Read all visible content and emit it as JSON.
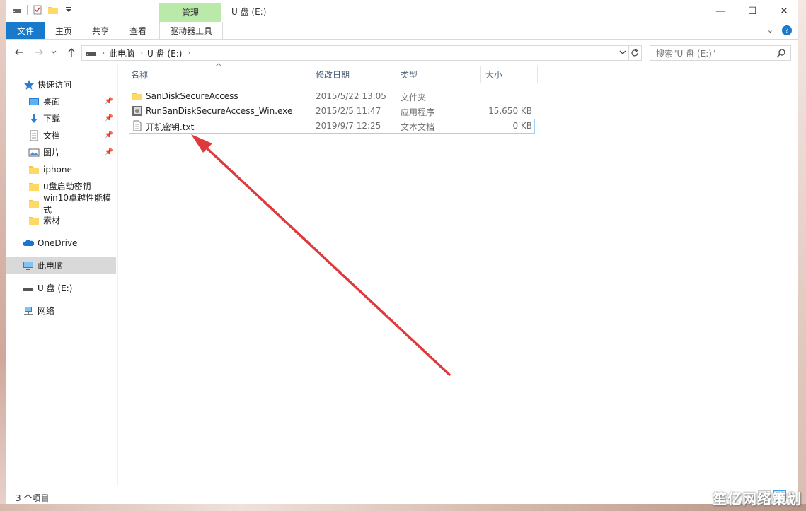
{
  "window": {
    "title": "U 盘 (E:)",
    "manage_tab": "管理",
    "controls": {
      "minimize": "—",
      "maximize": "☐",
      "close": "✕"
    }
  },
  "ribbon": {
    "tabs": [
      "文件",
      "主页",
      "共享",
      "查看",
      "驱动器工具"
    ],
    "expand_glyph": "⌄",
    "help_glyph": "?"
  },
  "address": {
    "crumbs": [
      "此电脑",
      "U 盘 (E:)"
    ],
    "search_placeholder": "搜索\"U 盘 (E:)\""
  },
  "sidebar": {
    "quick_access": "快速访问",
    "pinned": [
      "桌面",
      "下载",
      "文档",
      "图片"
    ],
    "folders": [
      "iphone",
      "u盘启动密钥",
      "win10卓越性能模式",
      "素材"
    ],
    "onedrive": "OneDrive",
    "this_pc": "此电脑",
    "usb": "U 盘 (E:)",
    "network": "网络"
  },
  "columns": [
    "名称",
    "修改日期",
    "类型",
    "大小"
  ],
  "files": [
    {
      "name": "SanDiskSecureAccess",
      "date": "2015/5/22 13:05",
      "type": "文件夹",
      "size": "",
      "icon": "folder-icon"
    },
    {
      "name": "RunSanDiskSecureAccess_Win.exe",
      "date": "2015/2/5 11:47",
      "type": "应用程序",
      "size": "15,650 KB",
      "icon": "exe-icon"
    },
    {
      "name": "开机密钥.txt",
      "date": "2019/9/7 12:25",
      "type": "文本文档",
      "size": "0 KB",
      "icon": "text-file-icon",
      "selected": true
    }
  ],
  "status": {
    "item_count": "3 个项目"
  },
  "watermark": "笙亿网络策划",
  "colors": {
    "accent": "#1979ca",
    "manage_tab": "#b9eaa9",
    "arrow": "#e0393c",
    "selection_border": "#99d1ff"
  }
}
